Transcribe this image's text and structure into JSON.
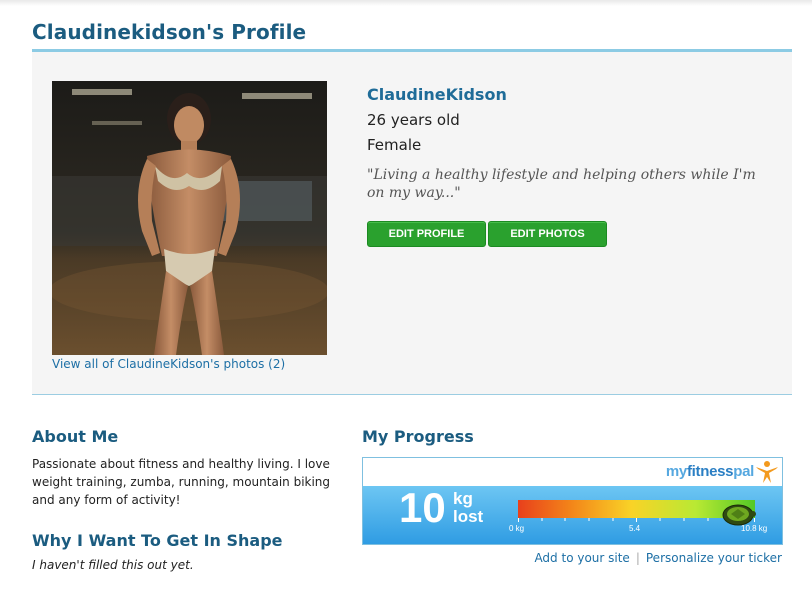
{
  "page": {
    "title": "Claudinekidson's Profile"
  },
  "profile": {
    "username": "ClaudineKidson",
    "age": "26 years old",
    "gender": "Female",
    "quote": "\"Living a healthy lifestyle and helping others while I'm on my way...\"",
    "photos_link": "View all of ClaudineKidson's photos (2)",
    "buttons": {
      "edit_profile": "EDIT PROFILE",
      "edit_photos": "EDIT PHOTOS"
    }
  },
  "about": {
    "heading": "About Me",
    "text": "Passionate about fitness and healthy living. I love weight training, zumba, running, mountain biking and any form of activity!"
  },
  "why": {
    "heading": "Why I Want To Get In Shape",
    "text": "I haven't filled this out yet."
  },
  "progress": {
    "heading": "My Progress",
    "ticker": {
      "logo_my": "my",
      "logo_fitness": "fitness",
      "logo_pal": "pal",
      "amount": "10",
      "unit_top": "kg",
      "unit_bottom": "lost",
      "scale_min": "0 kg",
      "scale_mid": "5.4",
      "scale_max": "10.8 kg",
      "progress_fraction": 0.93
    },
    "links": {
      "add": "Add to your site",
      "personalize": "Personalize your ticker"
    }
  },
  "colors": {
    "heading": "#1b5c80",
    "link": "#1d6fa5",
    "button": "#2aa12e",
    "rule": "#8ccbe4"
  }
}
